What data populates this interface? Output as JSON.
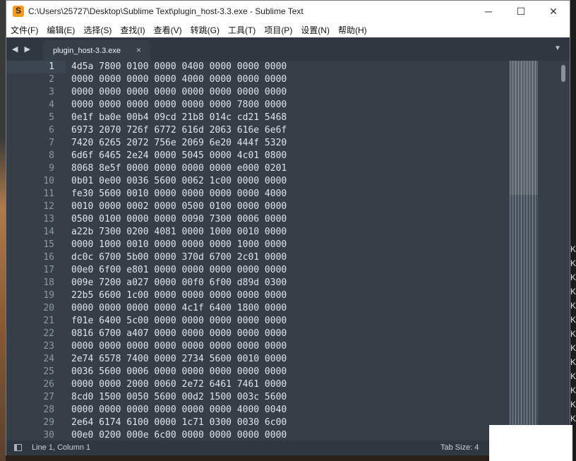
{
  "window": {
    "title": "C:\\Users\\25727\\Desktop\\Sublime Text\\plugin_host-3.3.exe - Sublime Text",
    "icon": "sublime-text-icon",
    "controls": {
      "minimize": "─",
      "maximize": "☐",
      "close": "✕"
    }
  },
  "menu": {
    "items": [
      "文件(F)",
      "编辑(E)",
      "选择(S)",
      "查找(I)",
      "查看(V)",
      "转跳(G)",
      "工具(T)",
      "项目(P)",
      "设置(N)",
      "帮助(H)"
    ]
  },
  "tabs": {
    "nav": "◀ ▶",
    "active": {
      "label": "plugin_host-3.3.exe",
      "close": "×"
    },
    "menu": "▼"
  },
  "editor": {
    "lines": [
      {
        "num": "1",
        "text": "4d5a 7800 0100 0000 0400 0000 0000 0000"
      },
      {
        "num": "2",
        "text": "0000 0000 0000 0000 4000 0000 0000 0000"
      },
      {
        "num": "3",
        "text": "0000 0000 0000 0000 0000 0000 0000 0000"
      },
      {
        "num": "4",
        "text": "0000 0000 0000 0000 0000 0000 7800 0000"
      },
      {
        "num": "5",
        "text": "0e1f ba0e 00b4 09cd 21b8 014c cd21 5468"
      },
      {
        "num": "6",
        "text": "6973 2070 726f 6772 616d 2063 616e 6e6f"
      },
      {
        "num": "7",
        "text": "7420 6265 2072 756e 2069 6e20 444f 5320"
      },
      {
        "num": "8",
        "text": "6d6f 6465 2e24 0000 5045 0000 4c01 0800"
      },
      {
        "num": "9",
        "text": "8068 8e5f 0000 0000 0000 0000 e000 0201"
      },
      {
        "num": "10",
        "text": "0b01 0e00 0036 5600 0062 1c00 0000 0000"
      },
      {
        "num": "11",
        "text": "fe30 5600 0010 0000 0000 0000 0000 4000"
      },
      {
        "num": "12",
        "text": "0010 0000 0002 0000 0500 0100 0000 0000"
      },
      {
        "num": "13",
        "text": "0500 0100 0000 0000 0090 7300 0006 0000"
      },
      {
        "num": "14",
        "text": "a22b 7300 0200 4081 0000 1000 0010 0000"
      },
      {
        "num": "15",
        "text": "0000 1000 0010 0000 0000 0000 1000 0000"
      },
      {
        "num": "16",
        "text": "dc0c 6700 5b00 0000 370d 6700 2c01 0000"
      },
      {
        "num": "17",
        "text": "00e0 6f00 e801 0000 0000 0000 0000 0000"
      },
      {
        "num": "18",
        "text": "009e 7200 a027 0000 00f0 6f00 d89d 0300"
      },
      {
        "num": "19",
        "text": "22b5 6600 1c00 0000 0000 0000 0000 0000"
      },
      {
        "num": "20",
        "text": "0000 0000 0000 0000 4c1f 6400 1800 0000"
      },
      {
        "num": "21",
        "text": "f01e 6400 5c00 0000 0000 0000 0000 0000"
      },
      {
        "num": "22",
        "text": "0816 6700 a407 0000 0000 0000 0000 0000"
      },
      {
        "num": "23",
        "text": "0000 0000 0000 0000 0000 0000 0000 0000"
      },
      {
        "num": "24",
        "text": "2e74 6578 7400 0000 2734 5600 0010 0000"
      },
      {
        "num": "25",
        "text": "0036 5600 0006 0000 0000 0000 0000 0000"
      },
      {
        "num": "26",
        "text": "0000 0000 2000 0060 2e72 6461 7461 0000"
      },
      {
        "num": "27",
        "text": "8cd0 1500 0050 5600 00d2 1500 003c 5600"
      },
      {
        "num": "28",
        "text": "0000 0000 0000 0000 0000 0000 4000 0040"
      },
      {
        "num": "29",
        "text": "2e64 6174 6100 0000 1c71 0300 0030 6c00"
      },
      {
        "num": "30",
        "text": "00e0 0200 000e 6c00 0000 0000 0000 0000"
      }
    ]
  },
  "status": {
    "position": "Line 1, Column 1",
    "tab_size": "Tab Size: 4"
  },
  "desktop_right_glyphs": [
    "K",
    "K",
    "K",
    "K",
    "K",
    "K",
    "K",
    "K",
    "K",
    "K",
    "K",
    "K",
    "K"
  ],
  "colors": {
    "editor_bg": "#363f48",
    "gutter_text": "#8d98a2",
    "code_text": "#dfe5ea",
    "accent": "#f29a1c"
  }
}
